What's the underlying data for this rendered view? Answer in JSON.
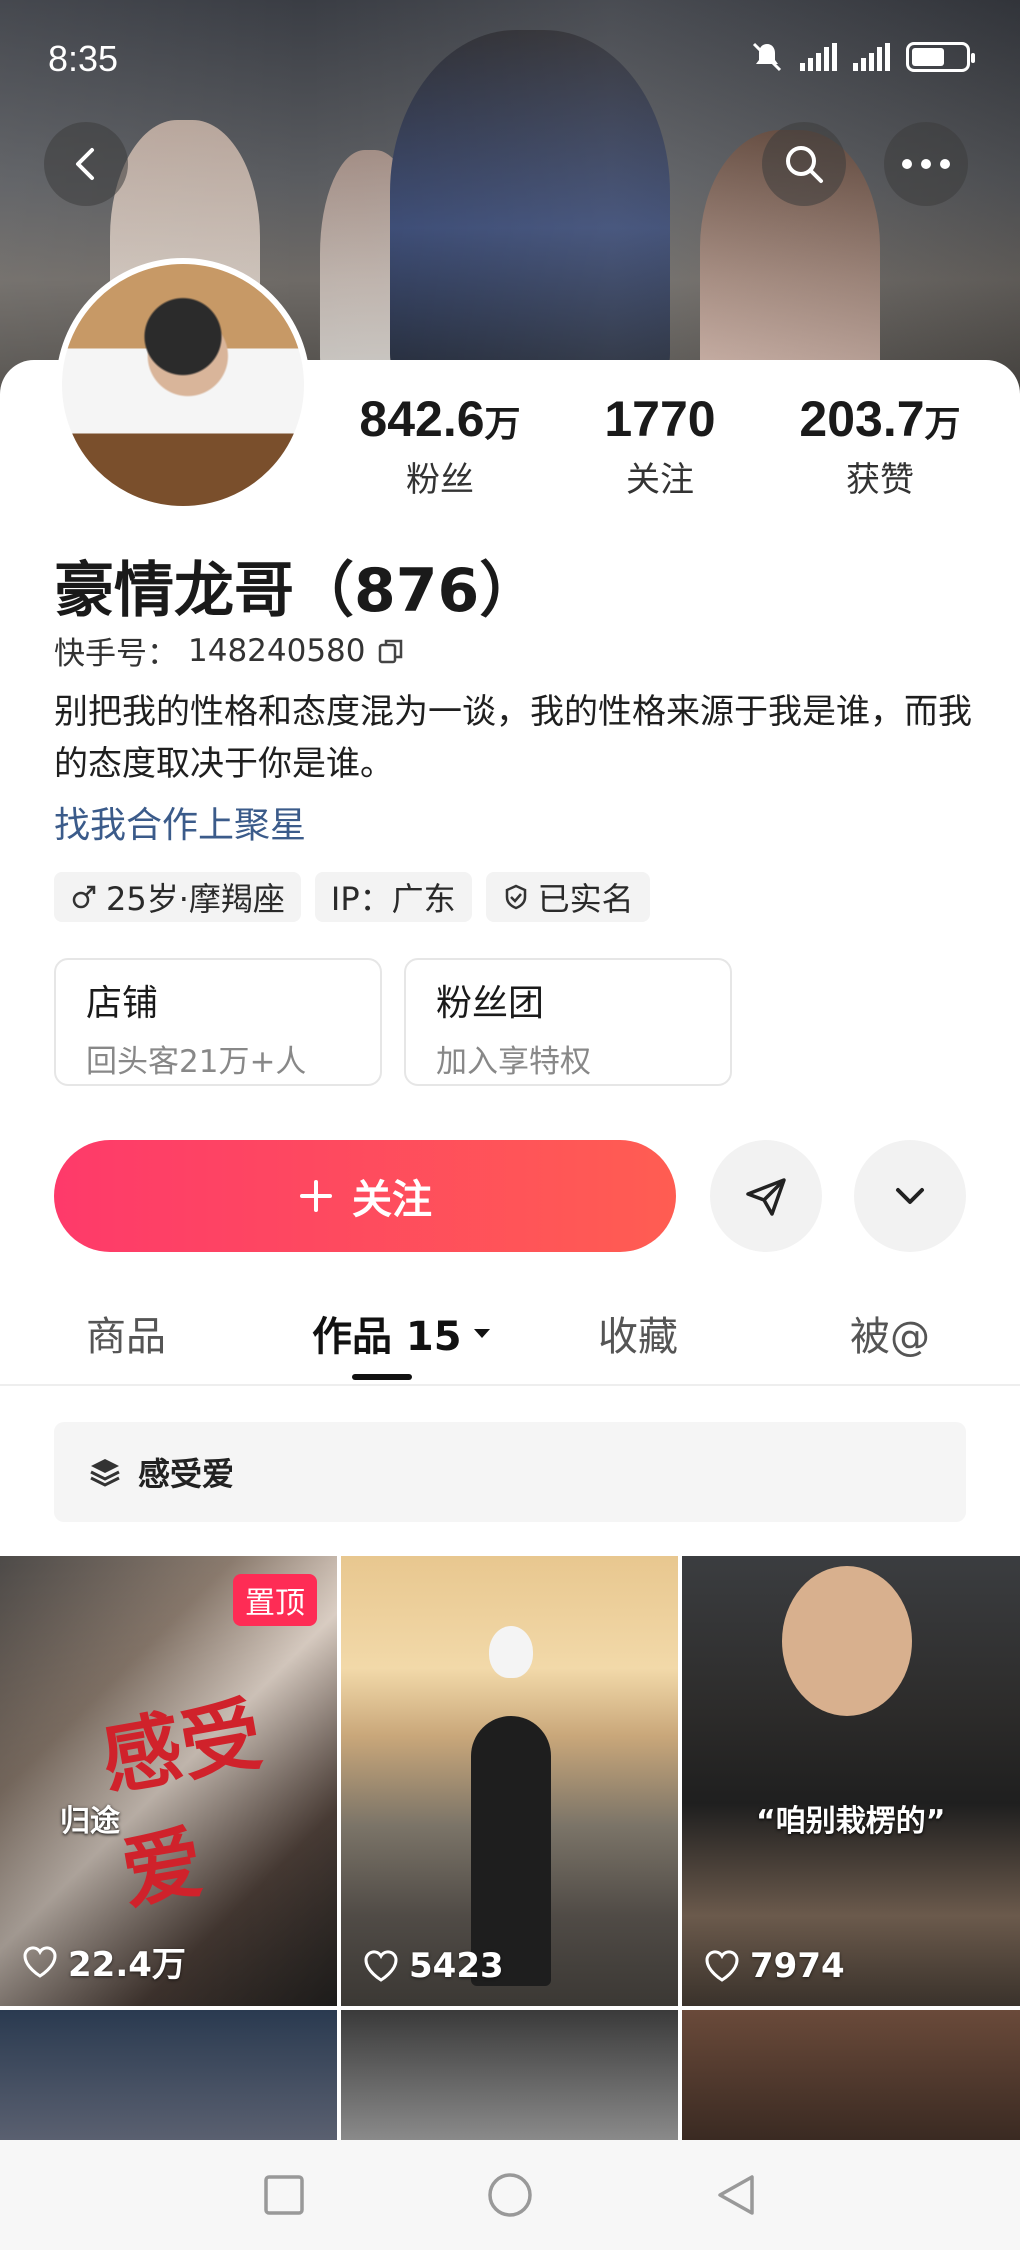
{
  "status_bar": {
    "time": "8:35"
  },
  "stats": [
    {
      "value": "842.6",
      "unit": "万",
      "label": "粉丝"
    },
    {
      "value": "1770",
      "unit": "",
      "label": "关注"
    },
    {
      "value": "203.7",
      "unit": "万",
      "label": "获赞"
    }
  ],
  "profile": {
    "name": "豪情龙哥（876）",
    "id_label": "快手号：",
    "id_value": "148240580",
    "bio": "别把我的性格和态度混为一谈，我的性格来源于我是谁，而我的态度取决于你是谁。",
    "coop_link": "找我合作上聚星",
    "tags": {
      "age": "25岁·摩羯座",
      "ip": "IP：广东",
      "verified": "已实名"
    }
  },
  "boxes": [
    {
      "title": "店铺",
      "subtitle": "回头客21万+人"
    },
    {
      "title": "粉丝团",
      "subtitle": "加入享特权"
    }
  ],
  "actions": {
    "follow_label": "关注"
  },
  "tabs": {
    "goods": "商品",
    "works": "作品 15",
    "favorites": "收藏",
    "mentions": "被@"
  },
  "collection": {
    "label": "感受爱"
  },
  "videos": [
    {
      "likes": "22.4万",
      "pinned": "置顶",
      "overlay_title": "感受爱",
      "overlay_sub": "归途"
    },
    {
      "likes": "5423"
    },
    {
      "likes": "7974",
      "caption": "“咱别栽楞的”"
    }
  ],
  "colors": {
    "accent_start": "#fe3a6a",
    "accent_end": "#ff5d52",
    "link": "#3b5b8a",
    "pin": "#fe2c55"
  }
}
